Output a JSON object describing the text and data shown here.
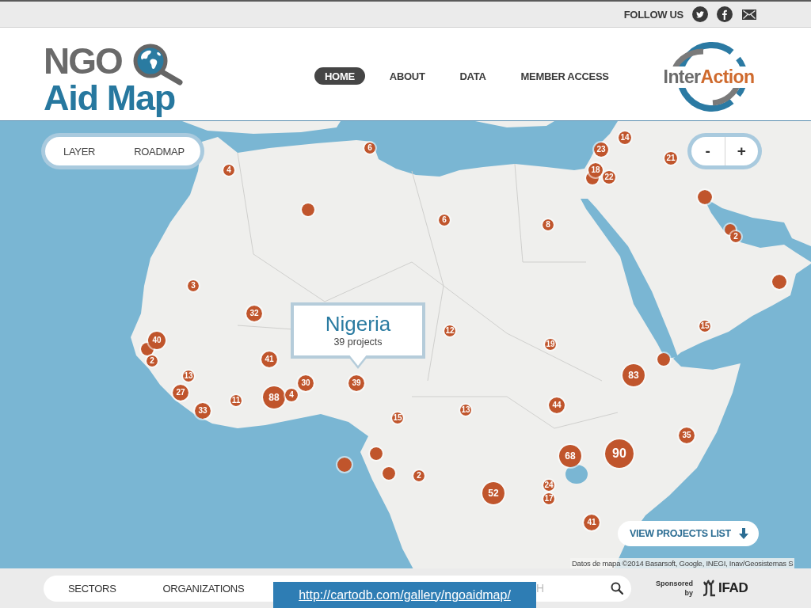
{
  "top_bar": {
    "follow_label": "FOLLOW US"
  },
  "header": {
    "logo": {
      "line_1": "NGO",
      "line_2": "Aid Map"
    },
    "nav": [
      {
        "label": "HOME",
        "selected": true
      },
      {
        "label": "ABOUT",
        "selected": false
      },
      {
        "label": "DATA",
        "selected": false
      },
      {
        "label": "MEMBER ACCESS",
        "selected": false
      }
    ],
    "partner_logo": {
      "text_parts": [
        "Inter",
        "Action"
      ]
    }
  },
  "map": {
    "layer_control": {
      "label": "LAYER",
      "value": "ROADMAP"
    },
    "zoom_controls": [
      "-",
      "+"
    ],
    "markers": [
      {
        "kind": "cluster",
        "count": "14"
      },
      {
        "kind": "cluster",
        "count": "6"
      },
      {
        "kind": "cluster",
        "count": "23"
      },
      {
        "kind": "cluster",
        "count": "21"
      },
      {
        "kind": "cluster",
        "count": "4"
      },
      {
        "kind": "dot"
      },
      {
        "kind": "cluster",
        "count": "18"
      },
      {
        "kind": "cluster",
        "count": "22"
      },
      {
        "kind": "dot"
      },
      {
        "kind": "dot"
      },
      {
        "kind": "cluster",
        "count": "6"
      },
      {
        "kind": "cluster",
        "count": "8"
      },
      {
        "kind": "dot"
      },
      {
        "kind": "cluster",
        "count": "2"
      },
      {
        "kind": "dot"
      },
      {
        "kind": "cluster",
        "count": "3"
      },
      {
        "kind": "cluster",
        "count": "32"
      },
      {
        "kind": "cluster",
        "count": "15"
      },
      {
        "kind": "cluster",
        "count": "12"
      },
      {
        "kind": "dot"
      },
      {
        "kind": "cluster",
        "count": "40"
      },
      {
        "kind": "cluster",
        "count": "19"
      },
      {
        "kind": "cluster",
        "count": "41"
      },
      {
        "kind": "dot"
      },
      {
        "kind": "cluster",
        "count": "2"
      },
      {
        "kind": "cluster",
        "count": "83"
      },
      {
        "kind": "cluster",
        "count": "13"
      },
      {
        "kind": "cluster",
        "count": "30"
      },
      {
        "kind": "cluster",
        "count": "39"
      },
      {
        "kind": "cluster",
        "count": "27"
      },
      {
        "kind": "cluster",
        "count": "88"
      },
      {
        "kind": "cluster",
        "count": "4"
      },
      {
        "kind": "cluster",
        "count": "11"
      },
      {
        "kind": "cluster",
        "count": "44"
      },
      {
        "kind": "cluster",
        "count": "13"
      },
      {
        "kind": "cluster",
        "count": "33"
      },
      {
        "kind": "cluster",
        "count": "15"
      },
      {
        "kind": "cluster",
        "count": "35"
      },
      {
        "kind": "cluster",
        "count": "90"
      },
      {
        "kind": "dot"
      },
      {
        "kind": "cluster",
        "count": "68"
      },
      {
        "kind": "dot"
      },
      {
        "kind": "dot"
      },
      {
        "kind": "cluster",
        "count": "2"
      },
      {
        "kind": "cluster",
        "count": "24"
      },
      {
        "kind": "cluster",
        "count": "52"
      },
      {
        "kind": "cluster",
        "count": "17"
      },
      {
        "kind": "cluster",
        "count": "41"
      }
    ],
    "popup": {
      "title": "Nigeria",
      "subtitle": "39 projects"
    },
    "projects_button": "VIEW PROJECTS LIST",
    "attribution": "Datos de mapa ©2014 Basarsoft, Google, INEGI, Inav/Geosistemas S"
  },
  "filter_bar": {
    "tabs": [
      "SECTORS",
      "ORGANIZATIONS"
    ],
    "search": {
      "placeholder": "H"
    },
    "sponsor_label": "Sponsored by",
    "sponsor_name": "IFAD"
  },
  "caption": {
    "url": "http://cartodb.com/gallery/ngoaidmap/"
  }
}
